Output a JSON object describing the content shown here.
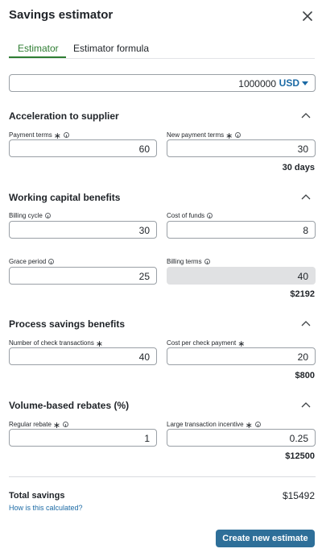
{
  "header": {
    "title": "Savings estimator"
  },
  "tabs": [
    {
      "label": "Estimator"
    },
    {
      "label": "Estimator formula"
    }
  ],
  "amount": {
    "value": "1000000",
    "currency": "USD"
  },
  "sections": {
    "acceleration": {
      "title": "Acceleration to supplier",
      "payment_terms": {
        "label": "Payment terms",
        "value": "60"
      },
      "new_payment_terms": {
        "label": "New payment terms",
        "value": "30"
      },
      "result": "30 days"
    },
    "working_capital": {
      "title": "Working capital benefits",
      "billing_cycle": {
        "label": "Billing cycle",
        "value": "30"
      },
      "cost_of_funds": {
        "label": "Cost of funds",
        "value": "8"
      },
      "grace_period": {
        "label": "Grace period",
        "value": "25"
      },
      "billing_terms": {
        "label": "Billing terms",
        "value": "40"
      },
      "result": "$2192"
    },
    "process_savings": {
      "title": "Process savings benefits",
      "check_transactions": {
        "label": "Number of check transactions",
        "value": "40"
      },
      "cost_per_check": {
        "label": "Cost per check payment",
        "value": "20"
      },
      "result": "$800"
    },
    "volume_rebates": {
      "title": "Volume-based rebates (%)",
      "regular_rebate": {
        "label": "Regular rebate",
        "value": "1"
      },
      "large_incentive": {
        "label": "Large transaction incentive",
        "value": "0.25"
      },
      "result": "$12500"
    }
  },
  "total": {
    "label": "Total savings",
    "value": "$15492",
    "link": "How is this calculated?"
  },
  "actions": {
    "create_label": "Create new estimate"
  },
  "colors": {
    "accent_green": "#2e7d32",
    "link_blue": "#1b6aa5",
    "button_blue": "#2e6f99"
  }
}
